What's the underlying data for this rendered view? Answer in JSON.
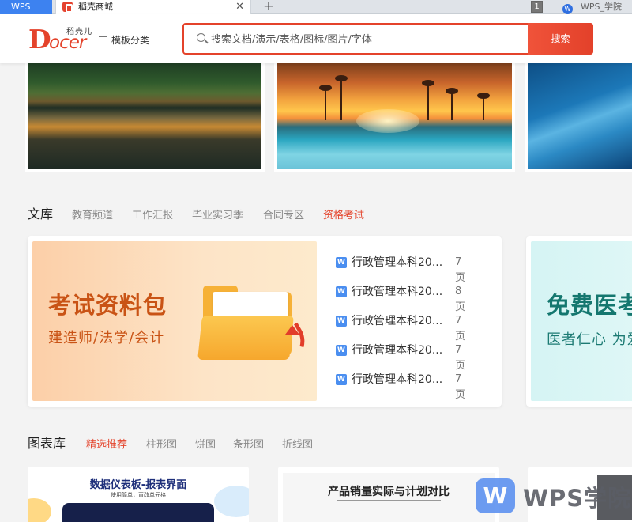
{
  "browser": {
    "wps_tab": "WPS",
    "active_tab_title": "稻壳商城",
    "close_glyph": "✕",
    "new_tab_glyph": "+",
    "tab_count": "1",
    "right_tab_icon": "W",
    "right_tab_label": "WPS_学院"
  },
  "header": {
    "logo_d": "D",
    "logo_ocer": "ocer",
    "logo_cn": "稻壳儿",
    "menu_label": "模板分类",
    "search_placeholder": "搜索文档/演示/表格/图标/图片/字体",
    "search_button": "搜索"
  },
  "library": {
    "title": "文库",
    "tabs": [
      "教育频道",
      "工作汇报",
      "毕业实习季",
      "合同专区",
      "资格考试"
    ],
    "active_tab_index": 4,
    "promo": {
      "headline": "考试资料包",
      "subline": "建造师/法学/会计"
    },
    "doc_icon": "W",
    "docs": [
      {
        "name": "行政管理本科20...",
        "pages": "7页"
      },
      {
        "name": "行政管理本科20...",
        "pages": "8页"
      },
      {
        "name": "行政管理本科20...",
        "pages": "7页"
      },
      {
        "name": "行政管理本科20...",
        "pages": "7页"
      },
      {
        "name": "行政管理本科20...",
        "pages": "7页"
      }
    ],
    "promo2": {
      "headline": "免费医考",
      "subline": "医者仁心 为爱"
    }
  },
  "charts": {
    "title": "图表库",
    "tabs": [
      "精选推荐",
      "柱形图",
      "饼图",
      "条形图",
      "折线图"
    ],
    "active_tab_index": 0,
    "thumb1_title": "数据仪表板-报表界面",
    "thumb1_sub": "使用简单，直改单元格",
    "thumb2_title": "产品销量实际与计划对比"
  },
  "watermark": {
    "logo_letter": "W",
    "text": "WPS学院"
  },
  "colors": {
    "brand_red": "#e4432b",
    "tab_blue": "#3d82f0"
  }
}
